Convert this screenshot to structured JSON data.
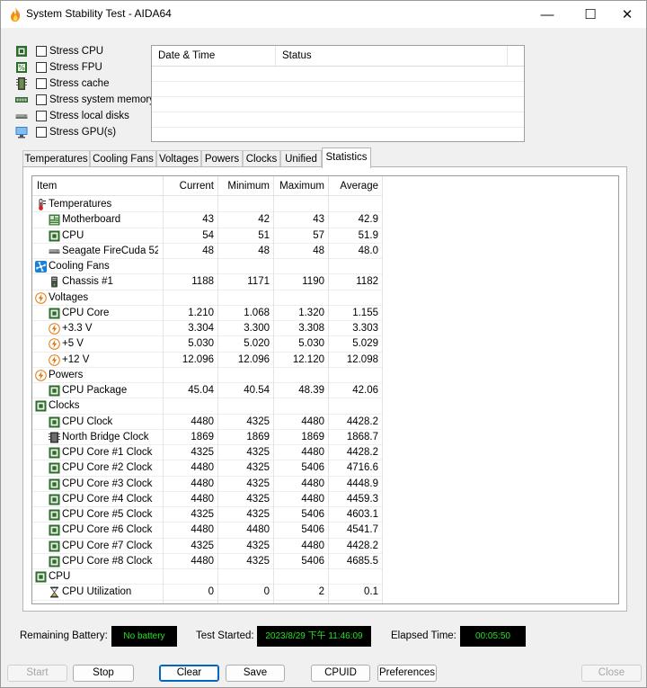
{
  "window": {
    "title": "System Stability Test - AIDA64",
    "minimize_symbol": "—",
    "maximize_symbol": "☐",
    "close_symbol": "✕"
  },
  "stress_options": [
    {
      "label": "Stress CPU",
      "icon": "cpu-chip-icon",
      "checked": false
    },
    {
      "label": "Stress FPU",
      "icon": "fpu-chip-icon",
      "checked": false
    },
    {
      "label": "Stress cache",
      "icon": "cache-module-icon",
      "checked": false
    },
    {
      "label": "Stress system memory",
      "icon": "memory-module-icon",
      "checked": false
    },
    {
      "label": "Stress local disks",
      "icon": "disk-drive-icon",
      "checked": false
    },
    {
      "label": "Stress GPU(s)",
      "icon": "monitor-icon",
      "checked": false
    }
  ],
  "log": {
    "columns": [
      "Date & Time",
      "Status"
    ]
  },
  "tabs": [
    "Temperatures",
    "Cooling Fans",
    "Voltages",
    "Powers",
    "Clocks",
    "Unified",
    "Statistics"
  ],
  "active_tab": "Statistics",
  "stats": {
    "columns": [
      "Item",
      "Current",
      "Minimum",
      "Maximum",
      "Average"
    ],
    "rows": [
      {
        "type": "group",
        "icon": "thermometer-icon",
        "item": "Temperatures"
      },
      {
        "type": "item",
        "icon": "motherboard-icon",
        "item": "Motherboard",
        "current": "43",
        "minimum": "42",
        "maximum": "43",
        "average": "42.9"
      },
      {
        "type": "item",
        "icon": "cpu-chip-icon",
        "item": "CPU",
        "current": "54",
        "minimum": "51",
        "maximum": "57",
        "average": "51.9"
      },
      {
        "type": "item",
        "icon": "disk-drive-icon",
        "item": "Seagate FireCuda 52...",
        "current": "48",
        "minimum": "48",
        "maximum": "48",
        "average": "48.0"
      },
      {
        "type": "group",
        "icon": "fan-icon",
        "item": "Cooling Fans"
      },
      {
        "type": "item",
        "icon": "chassis-icon",
        "item": "Chassis #1",
        "current": "1188",
        "minimum": "1171",
        "maximum": "1190",
        "average": "1182"
      },
      {
        "type": "group",
        "icon": "voltage-icon",
        "item": "Voltages"
      },
      {
        "type": "item",
        "icon": "cpu-chip-icon",
        "item": "CPU Core",
        "current": "1.210",
        "minimum": "1.068",
        "maximum": "1.320",
        "average": "1.155"
      },
      {
        "type": "item",
        "icon": "voltage-icon",
        "item": "+3.3 V",
        "current": "3.304",
        "minimum": "3.300",
        "maximum": "3.308",
        "average": "3.303"
      },
      {
        "type": "item",
        "icon": "voltage-icon",
        "item": "+5 V",
        "current": "5.030",
        "minimum": "5.020",
        "maximum": "5.030",
        "average": "5.029"
      },
      {
        "type": "item",
        "icon": "voltage-icon",
        "item": "+12 V",
        "current": "12.096",
        "minimum": "12.096",
        "maximum": "12.120",
        "average": "12.098"
      },
      {
        "type": "group",
        "icon": "power-icon",
        "item": "Powers"
      },
      {
        "type": "item",
        "icon": "cpu-chip-icon",
        "item": "CPU Package",
        "current": "45.04",
        "minimum": "40.54",
        "maximum": "48.39",
        "average": "42.06"
      },
      {
        "type": "group",
        "icon": "clock-chip-icon",
        "item": "Clocks"
      },
      {
        "type": "item",
        "icon": "cpu-chip-icon",
        "item": "CPU Clock",
        "current": "4480",
        "minimum": "4325",
        "maximum": "4480",
        "average": "4428.2"
      },
      {
        "type": "item",
        "icon": "northbridge-icon",
        "item": "North Bridge Clock",
        "current": "1869",
        "minimum": "1869",
        "maximum": "1869",
        "average": "1868.7"
      },
      {
        "type": "item",
        "icon": "cpu-chip-icon",
        "item": "CPU Core #1 Clock",
        "current": "4325",
        "minimum": "4325",
        "maximum": "4480",
        "average": "4428.2"
      },
      {
        "type": "item",
        "icon": "cpu-chip-icon",
        "item": "CPU Core #2 Clock",
        "current": "4480",
        "minimum": "4325",
        "maximum": "5406",
        "average": "4716.6"
      },
      {
        "type": "item",
        "icon": "cpu-chip-icon",
        "item": "CPU Core #3 Clock",
        "current": "4480",
        "minimum": "4325",
        "maximum": "4480",
        "average": "4448.9"
      },
      {
        "type": "item",
        "icon": "cpu-chip-icon",
        "item": "CPU Core #4 Clock",
        "current": "4480",
        "minimum": "4325",
        "maximum": "4480",
        "average": "4459.3"
      },
      {
        "type": "item",
        "icon": "cpu-chip-icon",
        "item": "CPU Core #5 Clock",
        "current": "4325",
        "minimum": "4325",
        "maximum": "5406",
        "average": "4603.1"
      },
      {
        "type": "item",
        "icon": "cpu-chip-icon",
        "item": "CPU Core #6 Clock",
        "current": "4480",
        "minimum": "4480",
        "maximum": "5406",
        "average": "4541.7"
      },
      {
        "type": "item",
        "icon": "cpu-chip-icon",
        "item": "CPU Core #7 Clock",
        "current": "4325",
        "minimum": "4325",
        "maximum": "4480",
        "average": "4428.2"
      },
      {
        "type": "item",
        "icon": "cpu-chip-icon",
        "item": "CPU Core #8 Clock",
        "current": "4480",
        "minimum": "4325",
        "maximum": "5406",
        "average": "4685.5"
      },
      {
        "type": "group",
        "icon": "cpu-chip-icon",
        "item": "CPU"
      },
      {
        "type": "item",
        "icon": "hourglass-icon",
        "item": "CPU Utilization",
        "current": "0",
        "minimum": "0",
        "maximum": "2",
        "average": "0.1"
      }
    ]
  },
  "status": {
    "battery_label": "Remaining Battery:",
    "battery_value": "No battery",
    "started_label": "Test Started:",
    "started_value": "2023/8/29 下午 11:46:09",
    "elapsed_label": "Elapsed Time:",
    "elapsed_value": "00:05:50",
    "value_color": "#21e221"
  },
  "buttons": {
    "start": "Start",
    "stop": "Stop",
    "clear": "Clear",
    "save": "Save",
    "cpuid": "CPUID",
    "preferences": "Preferences",
    "close": "Close"
  }
}
